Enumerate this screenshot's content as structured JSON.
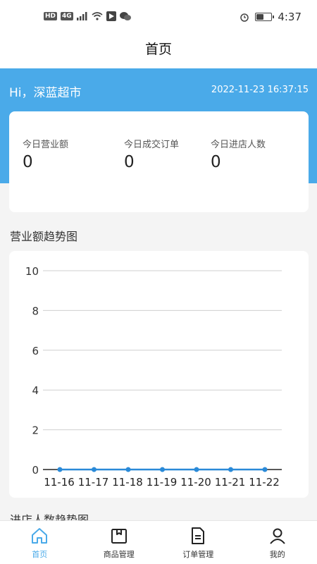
{
  "status_bar": {
    "indicators": [
      "HD",
      "4G"
    ],
    "time": "4:37",
    "icons": [
      "signal-icon",
      "wifi-icon",
      "app-notification-icon",
      "wechat-icon",
      "alarm-icon",
      "battery-icon"
    ],
    "battery_level": 0.55
  },
  "header": {
    "title": "首页"
  },
  "banner": {
    "greeting": "Hi，深蓝超市",
    "datetime": "2022-11-23 16:37:15",
    "accent_color": "#4aaae9"
  },
  "stats": [
    {
      "label": "今日营业额",
      "value": "0"
    },
    {
      "label": "今日成交订单",
      "value": "0"
    },
    {
      "label": "今日进店人数",
      "value": "0"
    }
  ],
  "sales_chart": {
    "title": "营业额趋势图"
  },
  "visitors_chart": {
    "title": "进店人数趋势图"
  },
  "chart_data": {
    "type": "line",
    "title": "营业额趋势图",
    "categories": [
      "11-16",
      "11-17",
      "11-18",
      "11-19",
      "11-20",
      "11-21",
      "11-22"
    ],
    "values": [
      0,
      0,
      0,
      0,
      0,
      0,
      0
    ],
    "ylim": [
      0,
      10
    ],
    "yticks": [
      0,
      2,
      4,
      6,
      8,
      10
    ],
    "grid": true,
    "line_color": "#2a8ad8"
  },
  "tabbar": {
    "items": [
      {
        "label": "首页",
        "icon": "home-icon",
        "active": true
      },
      {
        "label": "商品管理",
        "icon": "product-box-icon",
        "active": false
      },
      {
        "label": "订单管理",
        "icon": "order-document-icon",
        "active": false
      },
      {
        "label": "我的",
        "icon": "user-icon",
        "active": false
      }
    ]
  }
}
